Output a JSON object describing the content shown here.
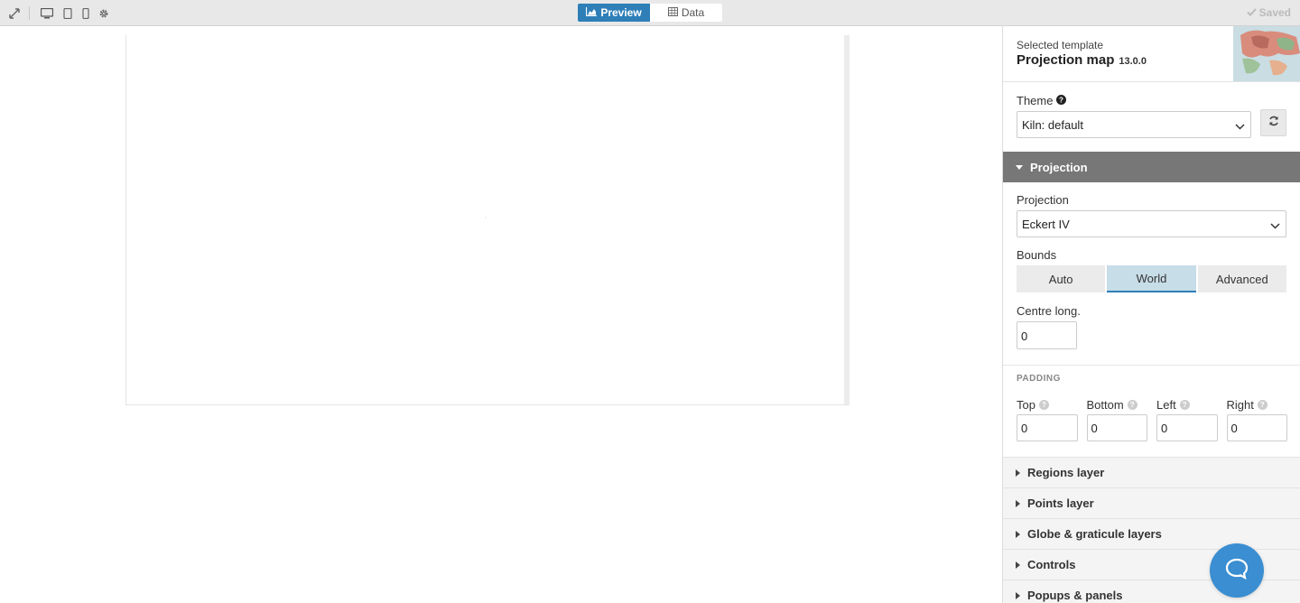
{
  "topbar": {
    "tabs": [
      {
        "label": "Preview",
        "icon": "area-chart-icon",
        "active": true
      },
      {
        "label": "Data",
        "icon": "table-icon",
        "active": false
      }
    ],
    "saved_label": "Saved",
    "icons": [
      "fullscreen-icon",
      "desktop-icon",
      "tablet-icon",
      "mobile-icon",
      "gear-icon"
    ]
  },
  "template": {
    "subtitle": "Selected template",
    "name": "Projection map",
    "version": "13.0.0"
  },
  "theme": {
    "label": "Theme",
    "value": "Kiln: default"
  },
  "projection_section": {
    "title": "Projection",
    "projection_label": "Projection",
    "projection_value": "Eckert IV",
    "bounds_label": "Bounds",
    "bounds_options": [
      "Auto",
      "World",
      "Advanced"
    ],
    "bounds_selected": "World",
    "centre_label": "Centre long.",
    "centre_value": "0",
    "padding_title": "PADDING",
    "padding": [
      {
        "label": "Top",
        "value": "0"
      },
      {
        "label": "Bottom",
        "value": "0"
      },
      {
        "label": "Left",
        "value": "0"
      },
      {
        "label": "Right",
        "value": "0"
      }
    ]
  },
  "collapsed_sections": [
    "Regions layer",
    "Points layer",
    "Globe & graticule layers",
    "Controls",
    "Popups & panels"
  ],
  "colors": {
    "accent": "#2e7fb8",
    "section_open": "#777777",
    "chat": "#3a8ed1"
  }
}
